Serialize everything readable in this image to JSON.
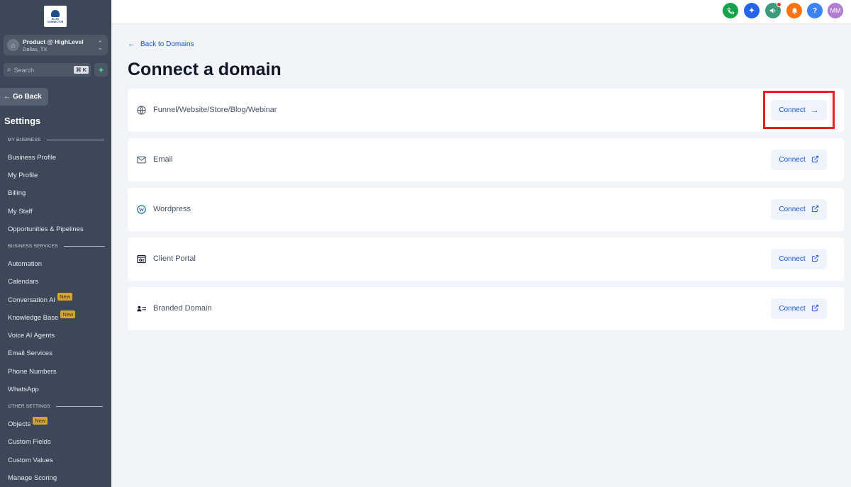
{
  "sidebar": {
    "logo_text": "ELITE CONNECTOR",
    "account": {
      "name": "Product @ HighLevel",
      "location": "Dallas, TX"
    },
    "search": {
      "placeholder": "Search",
      "shortcut": "⌘ K"
    },
    "go_back": "Go Back",
    "settings_title": "Settings",
    "sections": {
      "my_business": "MY BUSINESS",
      "business_services": "BUSINESS SERVICES",
      "other_settings": "OTHER SETTINGS"
    },
    "items": [
      {
        "label": "Business Profile"
      },
      {
        "label": "My Profile"
      },
      {
        "label": "Billing"
      },
      {
        "label": "My Staff"
      },
      {
        "label": "Opportunities & Pipelines"
      },
      {
        "label": "Automation"
      },
      {
        "label": "Calendars"
      },
      {
        "label": "Conversation AI",
        "badge": "New"
      },
      {
        "label": "Knowledge Base",
        "badge": "New"
      },
      {
        "label": "Voice AI Agents"
      },
      {
        "label": "Email Services"
      },
      {
        "label": "Phone Numbers"
      },
      {
        "label": "WhatsApp"
      },
      {
        "label": "Objects",
        "badge": "New"
      },
      {
        "label": "Custom Fields"
      },
      {
        "label": "Custom Values"
      },
      {
        "label": "Manage Scoring"
      }
    ]
  },
  "topbar": {
    "icons": [
      {
        "name": "phone-icon",
        "color": "#16a34a"
      },
      {
        "name": "magic-icon",
        "color": "#2563eb"
      },
      {
        "name": "megaphone-icon",
        "color": "#3d9a79"
      },
      {
        "name": "bell-icon",
        "color": "#f97316"
      },
      {
        "name": "help-icon",
        "color": "#3b82f6",
        "glyph": "?"
      }
    ],
    "avatar": {
      "initials": "MM",
      "color": "#b07ccf"
    }
  },
  "main": {
    "back_link": "Back to Domains",
    "title": "Connect a domain",
    "options": [
      {
        "label": "Funnel/Website/Store/Blog/Webinar",
        "icon": "globe-icon",
        "button": "Connect",
        "button_icon": "arrow-right-icon"
      },
      {
        "label": "Email",
        "icon": "mail-icon",
        "button": "Connect",
        "button_icon": "external-link-icon"
      },
      {
        "label": "Wordpress",
        "icon": "wordpress-icon",
        "button": "Connect",
        "button_icon": "external-link-icon"
      },
      {
        "label": "Client Portal",
        "icon": "client-portal-icon",
        "button": "Connect",
        "button_icon": "external-link-icon"
      },
      {
        "label": "Branded Domain",
        "icon": "branded-domain-icon",
        "button": "Connect",
        "button_icon": "external-link-icon"
      }
    ]
  },
  "colors": {
    "sidebar": "#3c4757",
    "accent": "#1a56c9",
    "highlight": "#e8221b",
    "badge": "#d4a531"
  }
}
